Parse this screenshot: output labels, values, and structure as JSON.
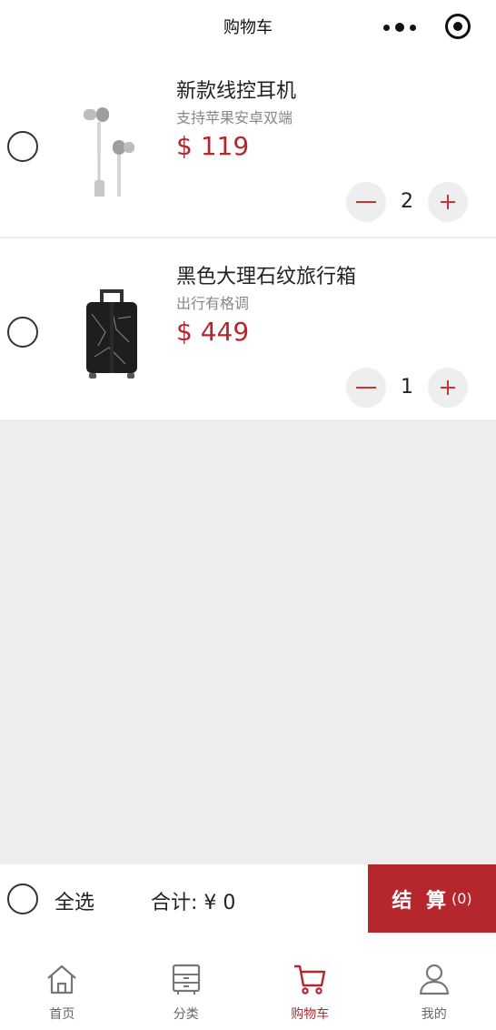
{
  "header": {
    "title": "购物车"
  },
  "cart": {
    "items": [
      {
        "name": "新款线控耳机",
        "subtitle": "支持苹果安卓双端",
        "price": "$ 119",
        "qty": "2",
        "image_icon": "earphones-image"
      },
      {
        "name": "黑色大理石纹旅行箱",
        "subtitle": "出行有格调",
        "price": "$ 449",
        "qty": "1",
        "image_icon": "suitcase-image"
      }
    ]
  },
  "checkout": {
    "select_all": "全选",
    "total": "合计: ¥ 0",
    "button_label": "结 算",
    "button_count": "(0)"
  },
  "tabbar": {
    "items": [
      {
        "label": "首页",
        "icon": "home-icon"
      },
      {
        "label": "分类",
        "icon": "category-icon"
      },
      {
        "label": "购物车",
        "icon": "cart-icon"
      },
      {
        "label": "我的",
        "icon": "user-icon"
      }
    ],
    "active_index": 2
  },
  "colors": {
    "accent": "#b5272d",
    "background": "#ededed"
  }
}
